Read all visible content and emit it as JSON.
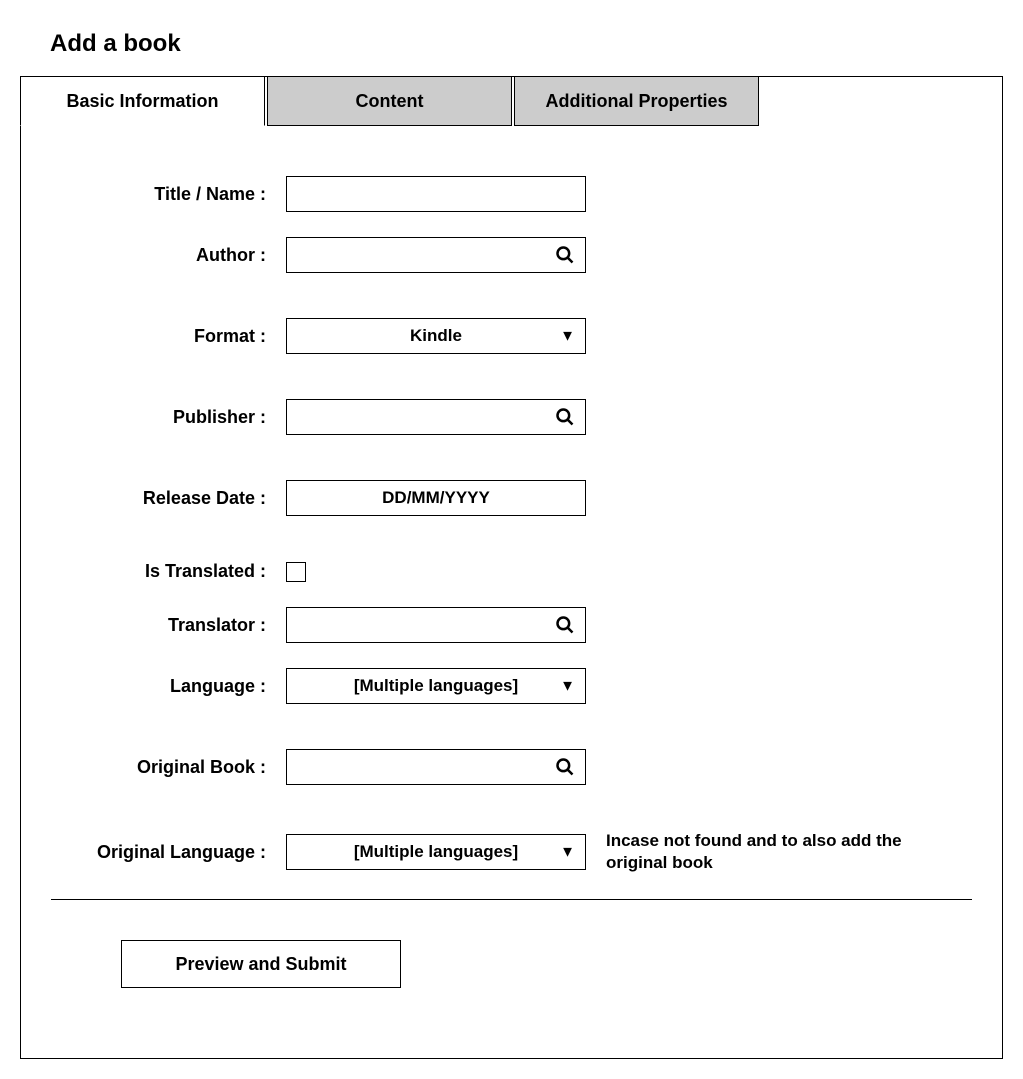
{
  "page_title": "Add a book",
  "tabs": [
    {
      "label": "Basic Information",
      "active": true
    },
    {
      "label": "Content",
      "active": false
    },
    {
      "label": "Additional Properties",
      "active": false
    }
  ],
  "fields": {
    "title": {
      "label": "Title / Name :",
      "value": ""
    },
    "author": {
      "label": "Author :",
      "value": ""
    },
    "format": {
      "label": "Format :",
      "value": "Kindle"
    },
    "publisher": {
      "label": "Publisher :",
      "value": ""
    },
    "release_date": {
      "label": "Release Date :",
      "placeholder": "DD/MM/YYYY"
    },
    "is_translated": {
      "label": "Is Translated :",
      "checked": false
    },
    "translator": {
      "label": "Translator :",
      "value": ""
    },
    "language": {
      "label": "Language :",
      "value": "[Multiple languages]"
    },
    "original_book": {
      "label": "Original Book :",
      "value": ""
    },
    "original_language": {
      "label": "Original Language :",
      "value": "[Multiple languages]",
      "hint": "Incase not found and to also add the original book"
    }
  },
  "submit_button": "Preview and Submit"
}
